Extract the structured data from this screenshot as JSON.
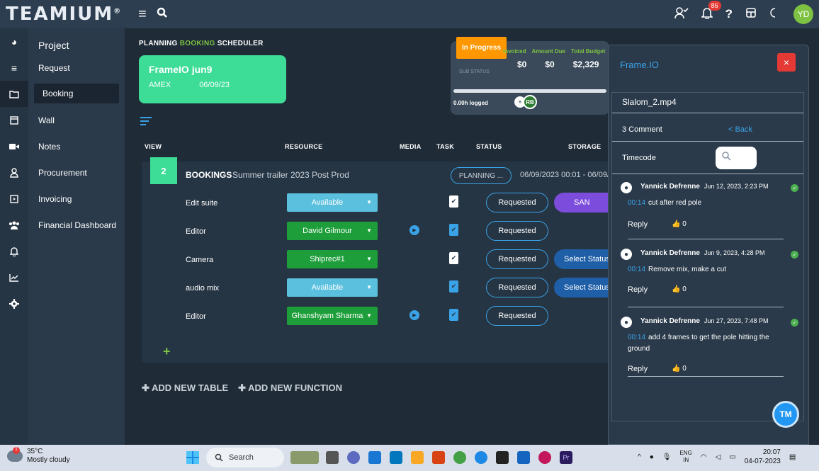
{
  "topbar": {
    "logo": "TEAMIUM",
    "logo_mark": "®",
    "notif_count": "86",
    "help": "?",
    "avatar": "YD"
  },
  "sidebar": {
    "title": "Project",
    "items": [
      "Request",
      "Booking",
      "Wall",
      "Notes",
      "Procurement",
      "Invoicing",
      "Financial Dashboard"
    ]
  },
  "crumbs": {
    "planning": "PLANNING",
    "booking": "BOOKING",
    "scheduler": "SCHEDULER"
  },
  "project_card": {
    "title": "FrameIO jun9",
    "client": "AMEX",
    "date": "06/09/23"
  },
  "status_box": {
    "status": "In Progress",
    "labels": [
      "Invoiced",
      "Amount Due",
      "Total Budget"
    ],
    "values": [
      "$0",
      "$0",
      "$2,329"
    ],
    "sub_status": "SUB STATUS",
    "logged": "0.00h logged",
    "avatar": "RB",
    "progress": 1.0
  },
  "columns": {
    "view": "VIEW",
    "resource": "RESOURCE",
    "media": "MEDIA",
    "task": "TASK",
    "status": "STATUS",
    "storage": "STORAGE"
  },
  "table": {
    "number": "2",
    "title": "BOOKINGS",
    "subtitle": "Summer trailer 2023  Post Prod",
    "phase": "PLANNING ...",
    "date_range": "06/09/2023 00:01 - 06/09/",
    "rows": [
      {
        "label": "Edit suite",
        "resource": "Available",
        "status": "Requested",
        "storage": "SAN"
      },
      {
        "label": "Editor",
        "resource": "David Gilmour",
        "status": "Requested",
        "storage": ""
      },
      {
        "label": "Camera",
        "resource": "Shiprec#1",
        "status": "Requested",
        "storage": "Select Status"
      },
      {
        "label": "audio mix",
        "resource": "Available",
        "status": "Requested",
        "storage": "Select Status"
      },
      {
        "label": "Editor",
        "resource": "Ghanshyam Sharma",
        "status": "Requested",
        "storage": ""
      }
    ],
    "add_row": "+"
  },
  "actions": {
    "add_table": "ADD NEW TABLE",
    "add_function": "ADD NEW FUNCTION"
  },
  "frameio": {
    "title": "Frame.IO",
    "close": "×",
    "file": "Slalom_2.mp4",
    "comment_count": "3 Comment",
    "back": "< Back",
    "timecode_label": "Timecode",
    "comments": [
      {
        "author": "Yannick Defrenne",
        "date": "Jun 12, 2023, 2:23 PM",
        "timecode": "00:14",
        "text": "cut after red pole",
        "reply": "Reply",
        "likes": "0"
      },
      {
        "author": "Yannick Defrenne",
        "date": "Jun 9, 2023, 4:28 PM",
        "timecode": "00:14",
        "text": "Remove mix, make a cut",
        "reply": "Reply",
        "likes": "0"
      },
      {
        "author": "Yannick Defrenne",
        "date": "Jun 27, 2023, 7:48 PM",
        "timecode": "00:14",
        "text": "add 4 frames to get the pole hitting the ground",
        "reply": "Reply",
        "likes": "0"
      }
    ]
  },
  "chat_bubble": "TM",
  "taskbar": {
    "temp": "35°C",
    "weather": "Mostly cloudy",
    "weather_badge": "1",
    "search": "Search",
    "lang1": "ENG",
    "lang2": "IN",
    "time": "20:07",
    "date": "04-07-2023"
  }
}
